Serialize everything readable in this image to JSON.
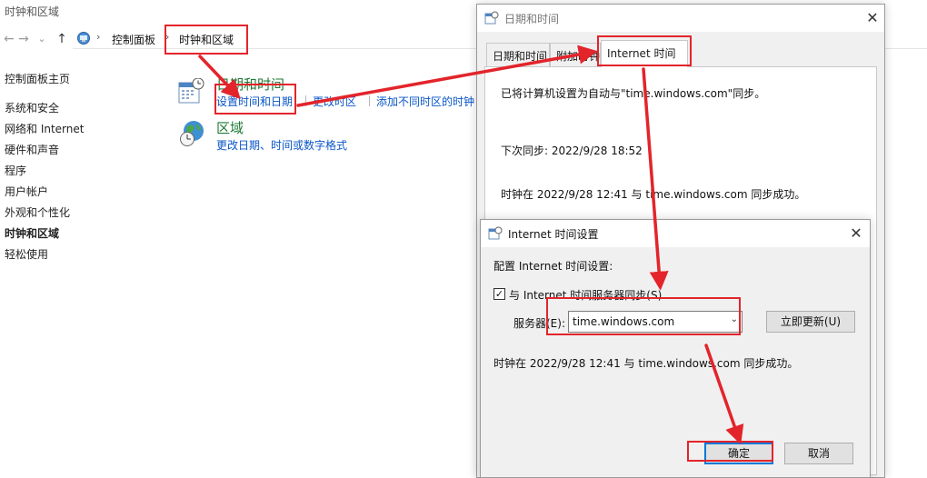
{
  "control_panel": {
    "window_title": "时钟和区域",
    "nav": {
      "back": "←",
      "forward": "→",
      "history": "⌄",
      "up": "↑"
    },
    "breadcrumb": [
      "控制面板",
      "时钟和区域"
    ],
    "breadcrumb_sep": "›",
    "sidebar": [
      {
        "label": "控制面板主页",
        "bold": false
      },
      {
        "label": "系统和安全",
        "bold": false
      },
      {
        "label": "网络和 Internet",
        "bold": false
      },
      {
        "label": "硬件和声音",
        "bold": false
      },
      {
        "label": "程序",
        "bold": false
      },
      {
        "label": "用户帐户",
        "bold": false
      },
      {
        "label": "外观和个性化",
        "bold": false
      },
      {
        "label": "时钟和区域",
        "bold": true
      },
      {
        "label": "轻松使用",
        "bold": false
      }
    ],
    "categories": [
      {
        "title": "日期和时间",
        "icon": "calendar-clock-icon",
        "links": [
          "设置时间和日期",
          "更改时区",
          "添加不同时区的时钟"
        ]
      },
      {
        "title": "区域",
        "icon": "globe-clock-icon",
        "links": [
          "更改日期、时间或数字格式"
        ]
      }
    ]
  },
  "date_time_dialog": {
    "title": "日期和时间",
    "close": "✕",
    "tabs": [
      "日期和时间",
      "附加时钟",
      "Internet 时间"
    ],
    "active_tab": "Internet 时间",
    "lines": [
      "已将计算机设置为自动与\"time.windows.com\"同步。",
      "下次同步: 2022/9/28 18:52",
      "时钟在 2022/9/28 12:41 与 time.windows.com 同步成功。"
    ]
  },
  "internet_time_dialog": {
    "title": "Internet 时间设置",
    "close": "✕",
    "heading": "配置 Internet 时间设置:",
    "checkbox_label": "与 Internet 时间服务器同步(S)",
    "checkbox_checked": true,
    "checkbox_mark": "✓",
    "server_label": "服务器(E):",
    "server_value": "time.windows.com",
    "server_caret": "⌄",
    "update_button": "立即更新(U)",
    "status": "时钟在 2022/9/28 12:41 与 time.windows.com 同步成功。",
    "ok_button": "确定",
    "cancel_button": "取消"
  },
  "colors": {
    "annotation_red": "#e3242b",
    "link_blue": "#0a56c8",
    "category_green": "#1f7a34",
    "accent": "#0078d7"
  }
}
